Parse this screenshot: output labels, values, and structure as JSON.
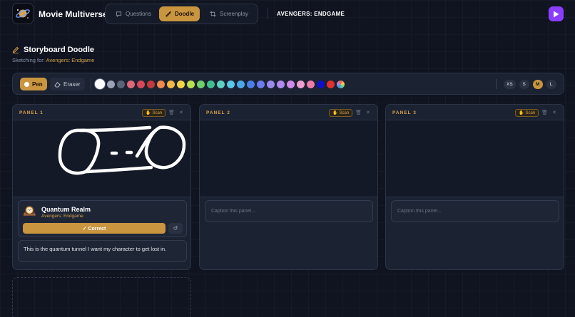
{
  "app": {
    "title": "Movie Multiverse",
    "logo_icon": "orbit-planet-icon"
  },
  "modes": [
    {
      "label": "Questions",
      "icon": "chat-icon",
      "active": false
    },
    {
      "label": "Doodle",
      "icon": "brush-icon",
      "active": true
    },
    {
      "label": "Screenplay",
      "icon": "crop-icon",
      "active": false
    }
  ],
  "header": {
    "movie_title": "AVENGERS: ENDGAME"
  },
  "colors": {
    "accent": "#c9953f",
    "play": "#8b3dff",
    "background": "#0f1420"
  },
  "section": {
    "title": "Storyboard Doodle",
    "sketching_prefix": "Sketching for: ",
    "sketching_movie": "Avengers: Endgame"
  },
  "toolbar": {
    "pen_label": "Pen",
    "eraser_label": "Eraser",
    "palette": [
      "#ffffff",
      "#9aa3b5",
      "#5a6378",
      "#e0677a",
      "#d9485a",
      "#c23a3a",
      "#f08a4b",
      "#f5b942",
      "#f5d342",
      "#b9e04f",
      "#6fcf6a",
      "#3fbf8f",
      "#5fd1c1",
      "#5ac8e8",
      "#4aa8e8",
      "#4a7fe8",
      "#6a7af0",
      "#9a8af0",
      "#b08af0",
      "#d08ae8",
      "#f0a0d0",
      "#f07aa8",
      "#1010c8",
      "#e03030",
      "#f0a050"
    ],
    "selected_color": 0,
    "sizes": [
      "XS",
      "S",
      "M",
      "L"
    ],
    "active_size": "M"
  },
  "panels": [
    {
      "label": "PANEL 1",
      "scan_label": "Scan",
      "has_drawing": true,
      "result": {
        "icon": "mantel-clock-icon",
        "name": "Quantum Realm",
        "movie": "Avengers: Endgame",
        "correct_label": "✓ Correct"
      },
      "caption": "This is the quantum tunnel I want my character to get lost in."
    },
    {
      "label": "PANEL 2",
      "scan_label": "Scan",
      "has_drawing": false,
      "caption_placeholder": "Caption this panel..."
    },
    {
      "label": "PANEL 3",
      "scan_label": "Scan",
      "has_drawing": false,
      "caption_placeholder": "Caption this panel..."
    }
  ]
}
